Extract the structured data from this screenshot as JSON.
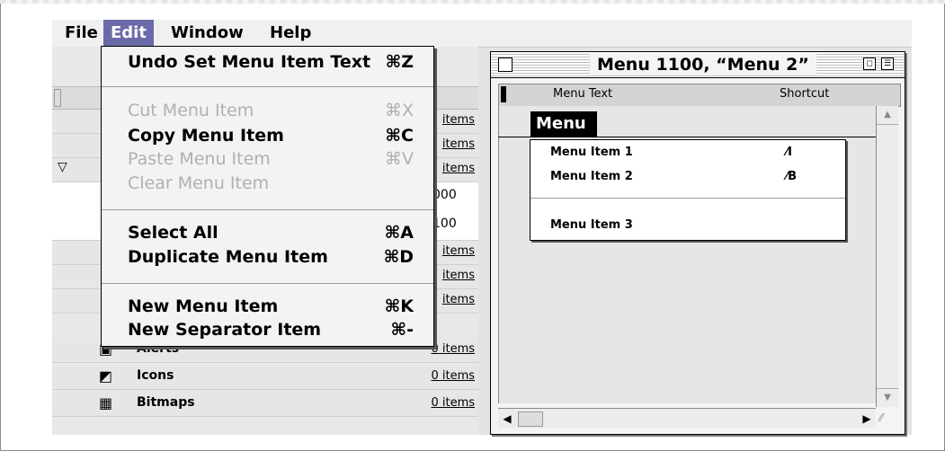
{
  "menubar": {
    "file": "File",
    "edit": "Edit",
    "window": "Window",
    "help": "Help"
  },
  "edit_menu": {
    "undo": {
      "label": "Undo Set Menu Item Text",
      "shortcut": "⌘Z"
    },
    "cut": {
      "label": "Cut Menu Item",
      "shortcut": "⌘X"
    },
    "copy": {
      "label": "Copy Menu Item",
      "shortcut": "⌘C"
    },
    "paste": {
      "label": "Paste Menu Item",
      "shortcut": "⌘V"
    },
    "clear": {
      "label": "Clear Menu Item"
    },
    "select_all": {
      "label": "Select All",
      "shortcut": "⌘A"
    },
    "duplicate": {
      "label": "Duplicate Menu Item",
      "shortcut": "⌘D"
    },
    "new_item": {
      "label": "New Menu Item",
      "shortcut": "⌘K"
    },
    "new_separator": {
      "label": "New Separator Item",
      "shortcut": "⌘-"
    }
  },
  "resource_list": {
    "rows": [
      {
        "count": "items"
      },
      {
        "count": "items"
      },
      {
        "count": "items"
      },
      {
        "count": "000"
      },
      {
        "count": "100"
      },
      {
        "count": "items"
      },
      {
        "count": "items"
      },
      {
        "count": "items"
      },
      {
        "name": "Alerts",
        "count": "0 items"
      },
      {
        "name": "Icons",
        "count": "0 items"
      },
      {
        "name": "Bitmaps",
        "count": "0 items"
      }
    ]
  },
  "menu_editor": {
    "title": "Menu 1100, “Menu 2”",
    "col_text": "Menu Text",
    "col_shortcut": "Shortcut",
    "menu_title": "Menu",
    "items": [
      {
        "label": "Menu Item 1",
        "shortcut": "⁄I"
      },
      {
        "label": "Menu Item 2",
        "shortcut": "⁄B"
      },
      {
        "label": "Menu Item 3",
        "shortcut": ""
      }
    ]
  }
}
